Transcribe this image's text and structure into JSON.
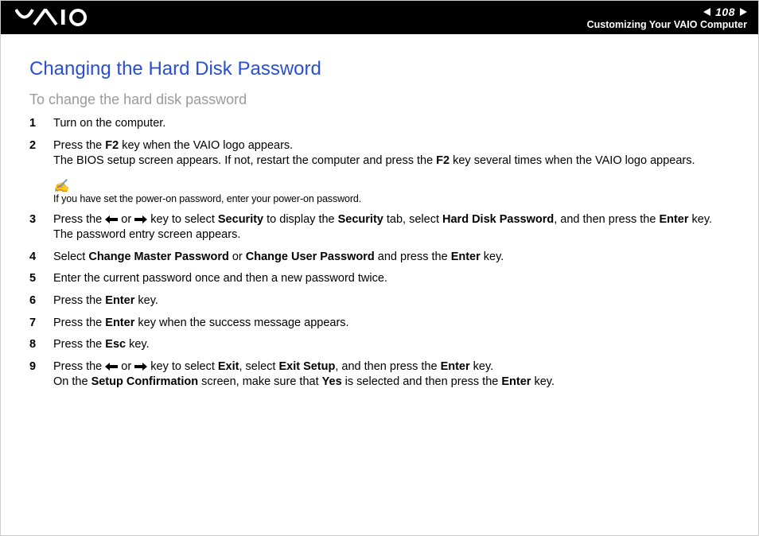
{
  "header": {
    "page_number": "108",
    "section": "Customizing Your VAIO Computer"
  },
  "title": "Changing the Hard Disk Password",
  "subtitle": "To change the hard disk password",
  "steps": {
    "s1": "Turn on the computer.",
    "s2_a": "Press the ",
    "s2_b": "F2",
    "s2_c": " key when the VAIO logo appears.",
    "s2_d": "The BIOS setup screen appears. If not, restart the computer and press the ",
    "s2_e": "F2",
    "s2_f": " key several times when the VAIO logo appears.",
    "note": "If you have set the power-on password, enter your power-on password.",
    "s3_a": "Press the ",
    "s3_b": " or ",
    "s3_c": " key to select ",
    "s3_d": "Security",
    "s3_e": " to display the ",
    "s3_f": "Security",
    "s3_g": " tab, select ",
    "s3_h": "Hard Disk Password",
    "s3_i": ", and then press the ",
    "s3_j": "Enter",
    "s3_k": " key.",
    "s3_l": "The password entry screen appears.",
    "s4_a": "Select ",
    "s4_b": "Change Master Password",
    "s4_c": " or ",
    "s4_d": "Change User Password",
    "s4_e": " and press the ",
    "s4_f": "Enter",
    "s4_g": " key.",
    "s5": "Enter the current password once and then a new password twice.",
    "s6_a": "Press the ",
    "s6_b": "Enter",
    "s6_c": " key.",
    "s7_a": "Press the ",
    "s7_b": "Enter",
    "s7_c": " key when the success message appears.",
    "s8_a": "Press the ",
    "s8_b": "Esc",
    "s8_c": " key.",
    "s9_a": "Press the ",
    "s9_b": " or ",
    "s9_c": " key to select ",
    "s9_d": "Exit",
    "s9_e": ", select ",
    "s9_f": "Exit Setup",
    "s9_g": ", and then press the ",
    "s9_h": "Enter",
    "s9_i": " key.",
    "s9_j": "On the ",
    "s9_k": "Setup Confirmation",
    "s9_l": " screen, make sure that ",
    "s9_m": "Yes",
    "s9_n": " is selected and then press the ",
    "s9_o": "Enter",
    "s9_p": " key."
  }
}
